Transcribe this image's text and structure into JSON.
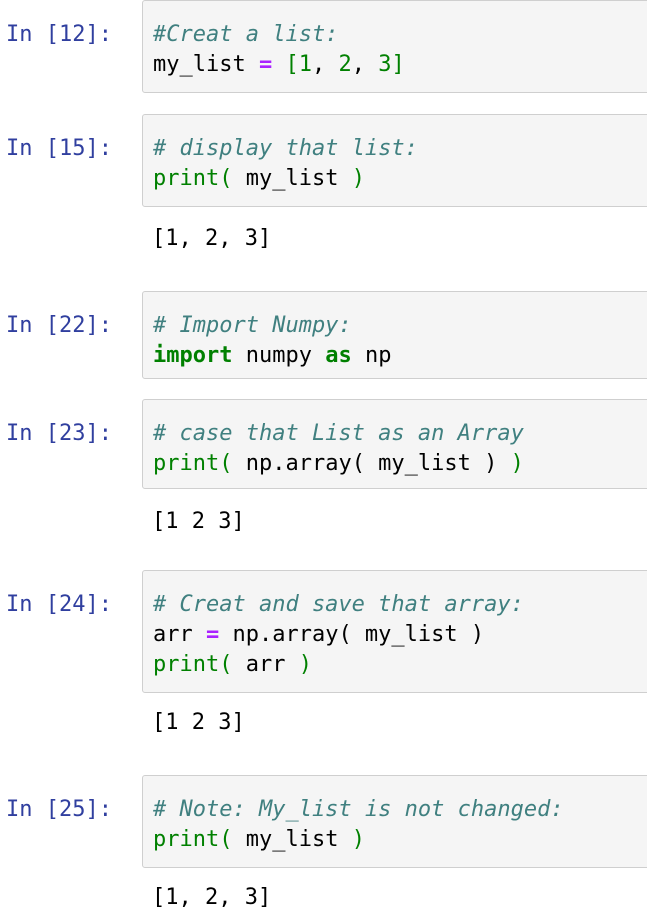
{
  "cells": [
    {
      "prompt": "In [12]:",
      "comment": "#Creat a list:",
      "line2": {
        "var": "my_list ",
        "op": "=",
        "open": " [",
        "n1": "1",
        "sep1": ", ",
        "n2": "2",
        "sep2": ", ",
        "n3": "3",
        "close": "]"
      }
    },
    {
      "prompt": "In [15]:",
      "comment": "# display that list:",
      "line2": {
        "fn": "print",
        "open": "(",
        "arg": " my_list ",
        "close": ")"
      },
      "output": "[1, 2, 3]"
    },
    {
      "prompt": "In [22]:",
      "comment": "# Import Numpy:",
      "line2": {
        "kw1": "import",
        "mod": " numpy ",
        "kw2": "as",
        "alias": " np"
      }
    },
    {
      "prompt": "In [23]:",
      "comment": "# case that List as an Array",
      "line2": {
        "fn": "print",
        "open": "(",
        "arg": " np.array( my_list ) ",
        "close": ")"
      },
      "output": "[1 2 3]"
    },
    {
      "prompt": "In [24]:",
      "comment": "# Creat and save that array:",
      "line2": {
        "var": "arr ",
        "op": "=",
        "rest": " np.array( my_list )"
      },
      "line3": {
        "fn": "print",
        "open": "(",
        "arg": " arr ",
        "close": ")"
      },
      "output": "[1 2 3]"
    },
    {
      "prompt": "In [25]:",
      "comment": "# Note: My_list is not changed:",
      "line2": {
        "fn": "print",
        "open": "(",
        "arg": " my_list ",
        "close": ")"
      },
      "output": "[1, 2, 3]"
    }
  ],
  "colors": {
    "prompt": "#303f9f",
    "comment": "#408080",
    "keyword": "#008000",
    "operator": "#aa22ff",
    "cell_bg": "#f5f5f5",
    "cell_border": "#cfcfcf"
  }
}
